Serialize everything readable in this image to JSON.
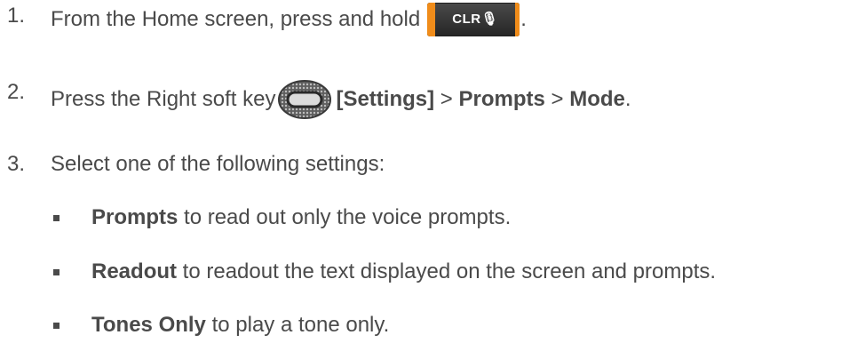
{
  "steps": [
    {
      "number": "1.",
      "text_before": "From the Home screen, press and hold",
      "key_label": "CLR",
      "key_icon": "microphone-icon",
      "text_after": "."
    },
    {
      "number": "2.",
      "text_before": "Press the Right soft key",
      "key_icon": "right-soft-key-icon",
      "bold_1": "[Settings]",
      "sep_1": ">",
      "bold_2": "Prompts",
      "sep_2": ">",
      "bold_3": "Mode",
      "text_after": "."
    },
    {
      "number": "3.",
      "text": "Select one of the following settings:"
    }
  ],
  "options": [
    {
      "bold": "Prompts",
      "text": "to read out only the voice prompts."
    },
    {
      "bold": "Readout",
      "text": "to readout the text displayed on the screen and prompts."
    },
    {
      "bold": "Tones Only",
      "text": "to play a tone only."
    }
  ],
  "colors": {
    "text": "#4a4a4a",
    "key_accent": "#f08c1a",
    "key_body": "#2f2f2f"
  }
}
